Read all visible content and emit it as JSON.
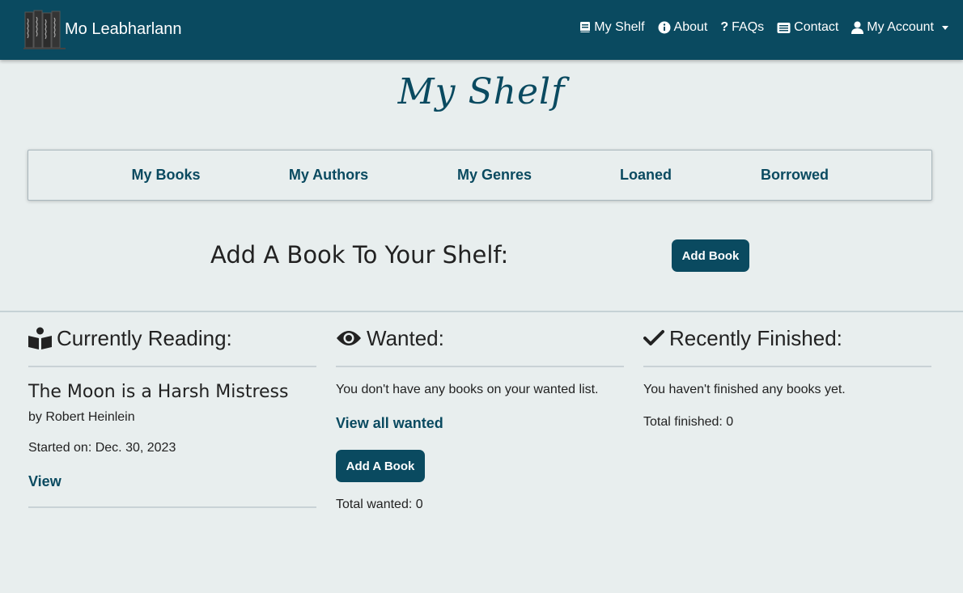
{
  "app": {
    "brand": "Mo Leabharlann"
  },
  "nav": {
    "items": [
      {
        "label": "My Shelf",
        "icon": "book-icon"
      },
      {
        "label": "About",
        "icon": "info-icon"
      },
      {
        "label": "FAQs",
        "icon": "question-icon"
      },
      {
        "label": "Contact",
        "icon": "envelope-icon"
      },
      {
        "label": "My Account",
        "icon": "user-icon"
      }
    ]
  },
  "page": {
    "title": "My Shelf"
  },
  "tabs": [
    "My Books",
    "My Authors",
    "My Genres",
    "Loaned",
    "Borrowed"
  ],
  "add_section": {
    "heading": "Add A Book To Your Shelf:",
    "button": "Add Book"
  },
  "currently_reading": {
    "heading": "Currently Reading:",
    "book_title": "The Moon is a Harsh Mistress",
    "author": "by Robert Heinlein",
    "started": "Started on: Dec. 30, 2023",
    "view_link": "View"
  },
  "wanted": {
    "heading": "Wanted:",
    "empty_text": "You don't have any books on your wanted list.",
    "view_all": "View all wanted",
    "add_button": "Add A Book",
    "total": "Total wanted: 0"
  },
  "finished": {
    "heading": "Recently Finished:",
    "empty_text": "You haven't finished any books yet.",
    "total": "Total finished: 0"
  },
  "colors": {
    "primary": "#0a4a60",
    "background": "#e8eeee"
  }
}
